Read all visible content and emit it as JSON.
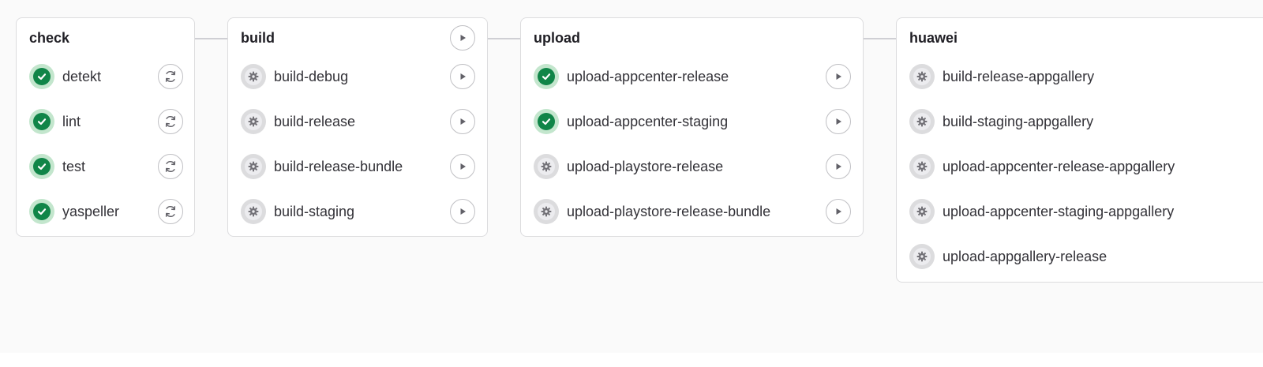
{
  "pipeline": {
    "stages": [
      {
        "name": "check",
        "jobs": [
          {
            "name": "detekt",
            "status": "success",
            "action": "retry"
          },
          {
            "name": "lint",
            "status": "success",
            "action": "retry"
          },
          {
            "name": "test",
            "status": "success",
            "action": "retry"
          },
          {
            "name": "yaspeller",
            "status": "success",
            "action": "retry"
          }
        ]
      },
      {
        "name": "build",
        "stage_action": "play",
        "jobs": [
          {
            "name": "build-debug",
            "status": "manual",
            "action": "play"
          },
          {
            "name": "build-release",
            "status": "manual",
            "action": "play"
          },
          {
            "name": "build-release-bundle",
            "status": "manual",
            "action": "play"
          },
          {
            "name": "build-staging",
            "status": "manual",
            "action": "play"
          }
        ]
      },
      {
        "name": "upload",
        "jobs": [
          {
            "name": "upload-appcenter-release",
            "status": "success",
            "action": "play"
          },
          {
            "name": "upload-appcenter-staging",
            "status": "success",
            "action": "play"
          },
          {
            "name": "upload-playstore-release",
            "status": "manual",
            "action": "play"
          },
          {
            "name": "upload-playstore-release-bundle",
            "status": "manual",
            "action": "play"
          }
        ]
      },
      {
        "name": "huawei",
        "jobs": [
          {
            "name": "build-release-appgallery",
            "status": "manual"
          },
          {
            "name": "build-staging-appgallery",
            "status": "manual"
          },
          {
            "name": "upload-appcenter-release-appgallery",
            "status": "manual"
          },
          {
            "name": "upload-appcenter-staging-appgallery",
            "status": "manual"
          },
          {
            "name": "upload-appgallery-release",
            "status": "manual"
          }
        ]
      }
    ]
  },
  "icons": {
    "success": "check-circle-icon",
    "manual": "gear-icon",
    "retry": "retry-icon",
    "play": "play-icon"
  },
  "colors": {
    "success": "#108548",
    "success_ring": "#c3e6cd",
    "manual": "#737278",
    "manual_ring": "#dcdcde",
    "canvas": "#fafafa",
    "connector": "#cfcfd4"
  }
}
